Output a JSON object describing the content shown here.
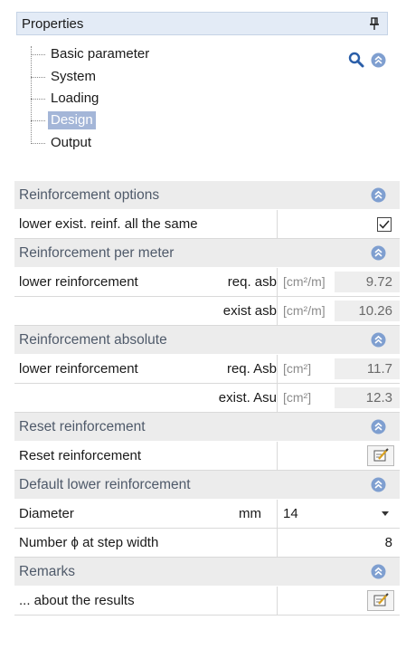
{
  "panel": {
    "title": "Properties"
  },
  "tree": {
    "items": [
      {
        "label": "Basic parameter",
        "selected": false
      },
      {
        "label": "System",
        "selected": false
      },
      {
        "label": "Loading",
        "selected": false
      },
      {
        "label": "Design",
        "selected": true
      },
      {
        "label": "Output",
        "selected": false
      }
    ]
  },
  "grid": {
    "sec_reinf_options": "Reinforcement options",
    "lower_exist_same": {
      "label": "lower exist. reinf. all the same",
      "checked": true
    },
    "sec_reinf_per_meter": "Reinforcement per meter",
    "per_meter_req": {
      "label": "lower reinforcement",
      "sub": "req. asb",
      "unit": "[cm²/m]",
      "value": "9.72"
    },
    "per_meter_exist": {
      "sub": "exist asb",
      "unit": "[cm²/m]",
      "value": "10.26"
    },
    "sec_reinf_absolute": "Reinforcement absolute",
    "abs_req": {
      "label": "lower reinforcement",
      "sub": "req. Asb",
      "unit": "[cm²]",
      "value": "11.7"
    },
    "abs_exist": {
      "sub": "exist. Asu",
      "unit": "[cm²]",
      "value": "12.3"
    },
    "sec_reset": "Reset reinforcement",
    "reset_row": {
      "label": "Reset reinforcement"
    },
    "sec_default_lower": "Default lower reinforcement",
    "diameter": {
      "label": "Diameter",
      "unit": "mm",
      "value": "14"
    },
    "number_phi": {
      "label": "Number ϕ at step width",
      "value": "8"
    },
    "sec_remarks": "Remarks",
    "remarks_row": {
      "label": "... about the results"
    }
  },
  "colors": {
    "header_bg": "#e3ebf6",
    "section_bg": "#ececec",
    "section_text": "#4f5a6a",
    "selected_bg": "#a4b6d8",
    "collapse_btn": "#7f9fd0"
  }
}
